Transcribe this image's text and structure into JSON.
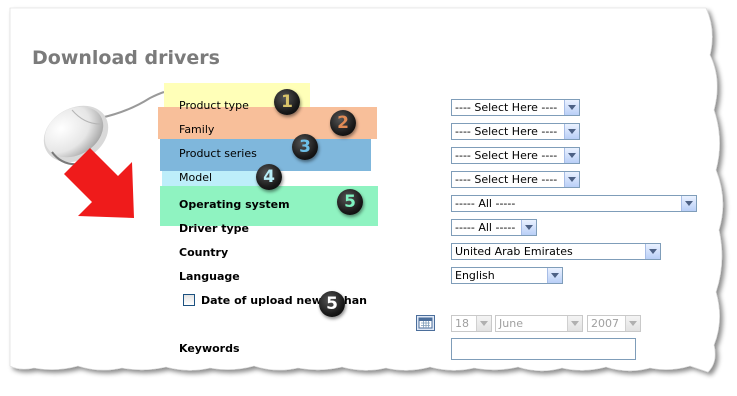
{
  "page": {
    "title": "Download drivers"
  },
  "callouts": {
    "product_type": "1",
    "family": "2",
    "product_series": "3",
    "model": "4",
    "operating_system": "5",
    "date_upload": "5"
  },
  "highlight_colors": {
    "product_type": "#ffffb8",
    "family": "#f8bf9a",
    "product_series": "#7fb7dc",
    "model": "#bdeefa",
    "operating_system": "#8ff3c1"
  },
  "callout_colors": {
    "product_type": "#d8c36a",
    "family": "#e08a55",
    "product_series": "#6dbfe7",
    "model": "#b8eef8",
    "operating_system": "#7ff2c0",
    "date_upload": "#ffffff"
  },
  "form": {
    "product_type": {
      "label": "Product type",
      "value": "---- Select Here ----"
    },
    "family": {
      "label": "Family",
      "value": "---- Select Here ----"
    },
    "product_series": {
      "label": "Product series",
      "value": "---- Select Here ----"
    },
    "model": {
      "label": "Model",
      "value": "---- Select Here ----"
    },
    "operating_system": {
      "label": "Operating system",
      "value": "----- All -----"
    },
    "driver_type": {
      "label": "Driver type",
      "value": "----- All -----"
    },
    "country": {
      "label": "Country",
      "value": "United Arab Emirates"
    },
    "language": {
      "label": "Language",
      "value": "English"
    },
    "date_upload": {
      "label": "Date of upload newer than",
      "day": "18",
      "month": "June",
      "year": "2007"
    },
    "keywords": {
      "label": "Keywords",
      "value": ""
    }
  },
  "icons": {
    "mouse": "computer-mouse-icon",
    "arrow": "red-arrow-icon",
    "calendar": "calendar-icon",
    "dropdown": "chevron-down-icon"
  }
}
